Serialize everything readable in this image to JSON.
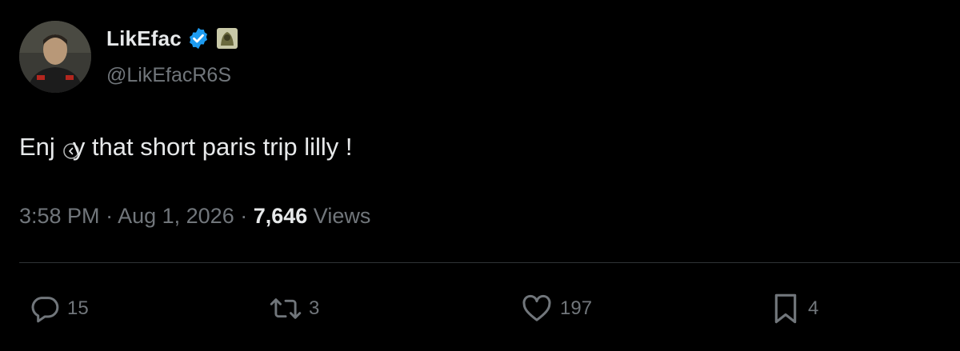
{
  "author": {
    "display_name": "LikEfac",
    "handle": "@LikEfacR6S",
    "verified_icon": "verified-badge-icon",
    "affiliation_icon": "affiliate-badge-icon"
  },
  "tweet": {
    "text_before": "Enj",
    "text_after": "y that short paris trip lilly !"
  },
  "meta": {
    "time": "3:58 PM",
    "sep1": " · ",
    "date": "Aug 1, 2026",
    "sep2": " · ",
    "views_count": "7,646",
    "views_label": " Views"
  },
  "actions": {
    "reply": {
      "icon": "reply-icon",
      "count": "15"
    },
    "retweet": {
      "icon": "retweet-icon",
      "count": "3"
    },
    "like": {
      "icon": "heart-icon",
      "count": "197"
    },
    "bookmark": {
      "icon": "bookmark-icon",
      "count": "4"
    }
  },
  "colors": {
    "background": "#000000",
    "text_primary": "#e7e9ea",
    "text_secondary": "#71767b",
    "verified_blue": "#1d9bf0",
    "divider": "#2f3336"
  }
}
